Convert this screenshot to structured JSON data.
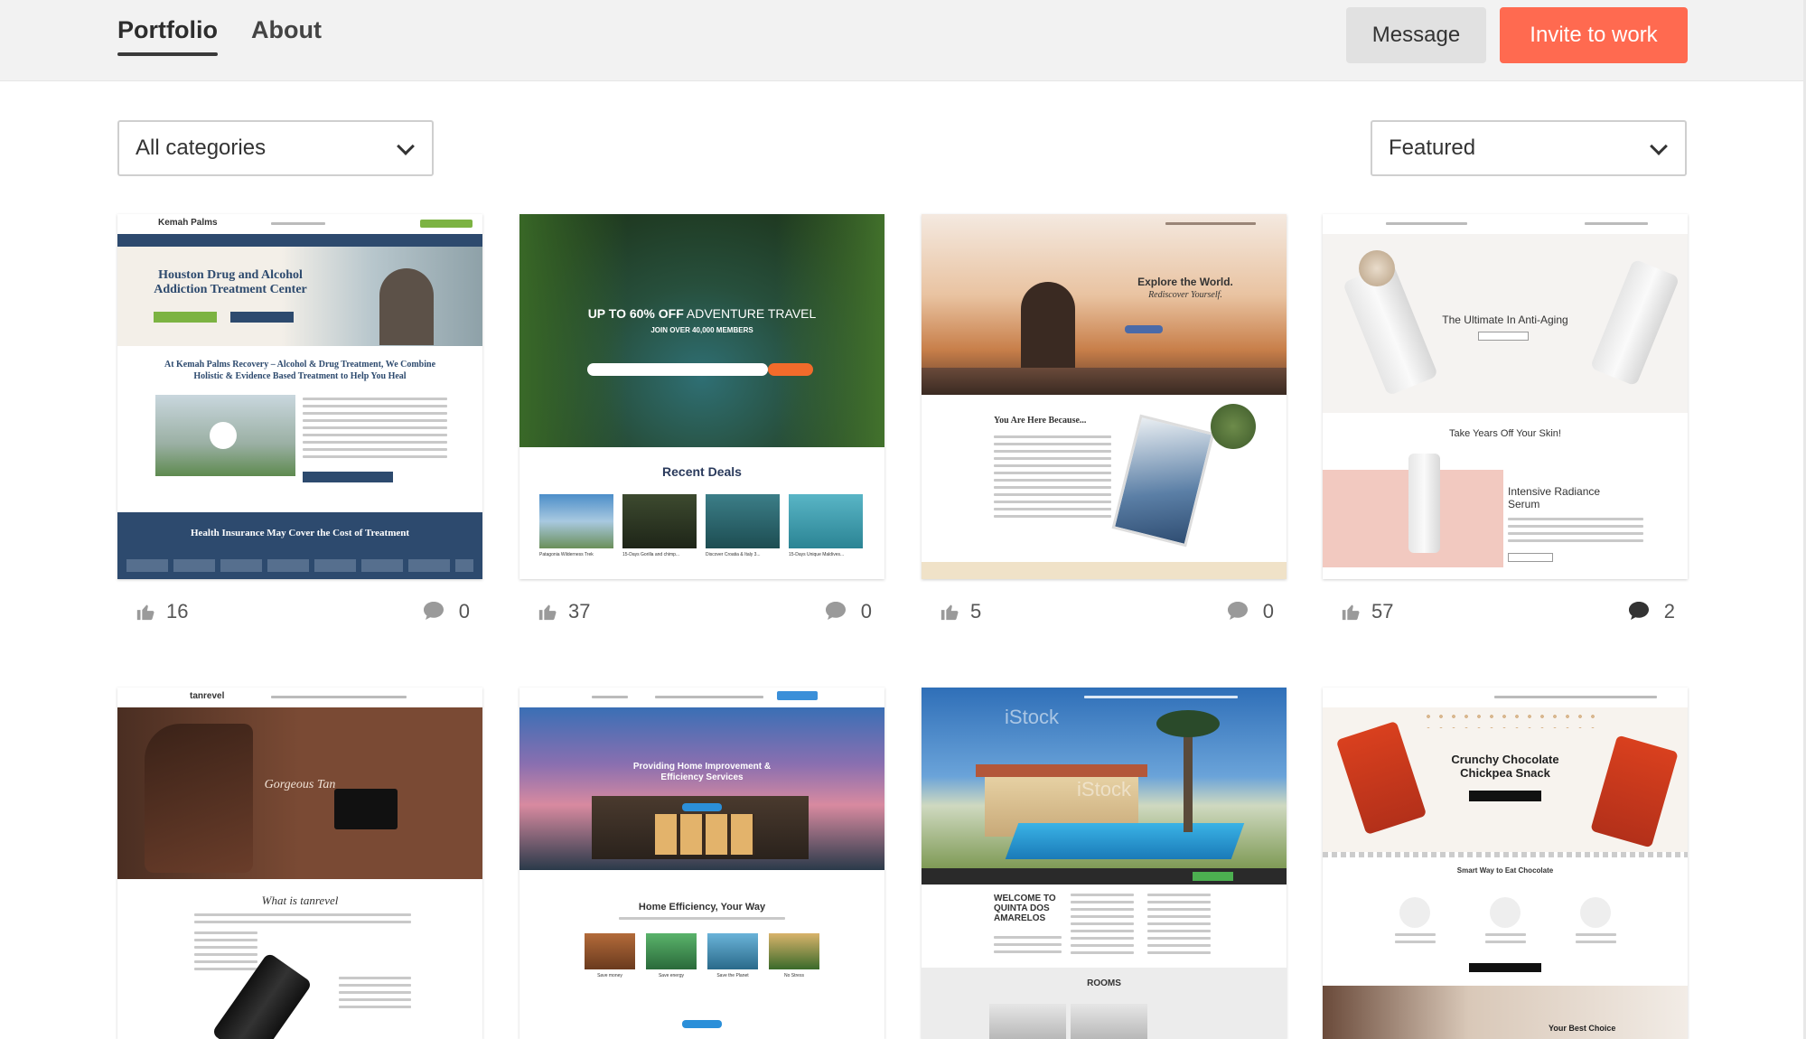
{
  "tabs": [
    {
      "label": "Portfolio",
      "active": true
    },
    {
      "label": "About",
      "active": false
    }
  ],
  "actions": {
    "message_label": "Message",
    "invite_label": "Invite to work"
  },
  "filters": {
    "category": "All categories",
    "sort": "Featured"
  },
  "colors": {
    "accent": "#ff6a50",
    "secondary_button": "#e1e1e1"
  },
  "projects": [
    {
      "likes": "16",
      "comments": "0",
      "headline": "Houston Drug and Alcohol Addiction Treatment Center",
      "subhead": "At Kemah Palms Recovery – Alcohol & Drug Treatment, We Combine Holistic & Evidence Based Treatment to Help You Heal",
      "footer": "Health Insurance May Cover the Cost of Treatment",
      "logo": "Kemah Palms"
    },
    {
      "likes": "37",
      "comments": "0",
      "headline_strong": "UP TO 60% OFF",
      "headline_rest": " ADVENTURE TRAVEL",
      "subhead": "JOIN OVER 40,000 MEMBERS",
      "section": "Recent Deals",
      "deals": [
        "Patagonia Wilderness Trek",
        "15-Days Gorilla and chimp...",
        "Discover Croatia & Italy 3...",
        "15-Days Unique Maldives..."
      ]
    },
    {
      "likes": "5",
      "comments": "0",
      "headline": "Explore the World.",
      "subhead": "Rediscover Yourself.",
      "section": "You Are Here Because..."
    },
    {
      "likes": "57",
      "comments": "2",
      "headline": "The Ultimate In Anti-Aging",
      "subhead": "Take Years Off Your Skin!",
      "section": "Intensive Radiance Serum"
    },
    {
      "headline": "Gorgeous Tan",
      "subhead": "What is tanrevel",
      "logo": "tanrevel"
    },
    {
      "headline": "Providing Home Improvement & Efficiency Services",
      "section": "Home Efficiency, Your Way",
      "items": [
        "Save money",
        "Save energy",
        "Save the Planet",
        "No Stress"
      ]
    },
    {
      "headline": "WELCOME TO QUINTA DOS AMARELOS",
      "section": "ROOMS",
      "watermark": "iStock"
    },
    {
      "headline": "Crunchy Chocolate Chickpea Snack",
      "subhead": "Smart Way to Eat Chocolate",
      "section": "Your Best Choice"
    }
  ]
}
